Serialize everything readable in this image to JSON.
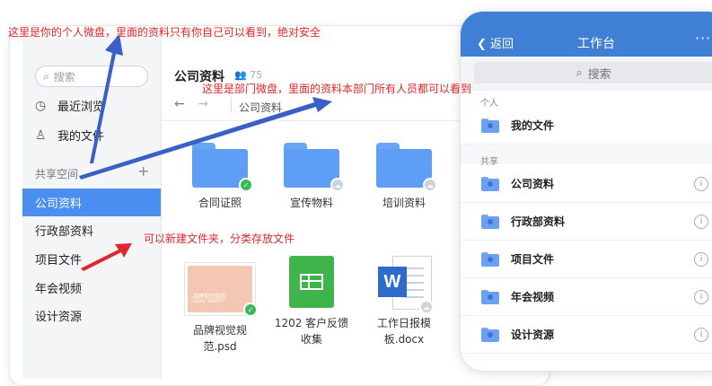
{
  "annotations": {
    "personal": "这里是你的个人微盘，里面的资料只有你自己可以看到，绝对安全",
    "department": "这里是部门微盘，里面的资料本部门所有人员都可以看到",
    "newfolder": "可以新建文件夹，分类存放文件"
  },
  "sidebar": {
    "search_placeholder": "搜索",
    "recent": "最近浏览",
    "my_files": "我的文件",
    "shared_title": "共享空间",
    "add": "+",
    "spaces": [
      "公司资料",
      "行政部资料",
      "项目文件",
      "年会视频",
      "设计资源"
    ]
  },
  "main": {
    "title": "公司资料",
    "member_count": "75",
    "breadcrumb": "公司资料",
    "folders": [
      "合同证照",
      "宣传物料",
      "培训资料"
    ],
    "files": [
      {
        "name_line1": "品牌视觉规",
        "name_line2": "范.psd",
        "thumb_title": "品牌视觉规范",
        "thumb_sub": "VISUAL IDENTITY"
      },
      {
        "name_line1": "1202 客户反馈",
        "name_line2": "收集"
      },
      {
        "name_line1": "工作日报模",
        "name_line2": "板.docx"
      }
    ]
  },
  "phone": {
    "back": "返回",
    "title": "工作台",
    "more": "···",
    "search_placeholder": "搜索",
    "section_personal": "个人",
    "my_files": "我的文件",
    "section_shared": "共享",
    "items": [
      "公司资料",
      "行政部资料",
      "项目文件",
      "年会视频",
      "设计资源"
    ]
  },
  "colors": {
    "accent": "#4a8ef0",
    "phone_header": "#3f7fd4",
    "annotation": "#e0262a",
    "arrow": "#3a5fc8"
  }
}
